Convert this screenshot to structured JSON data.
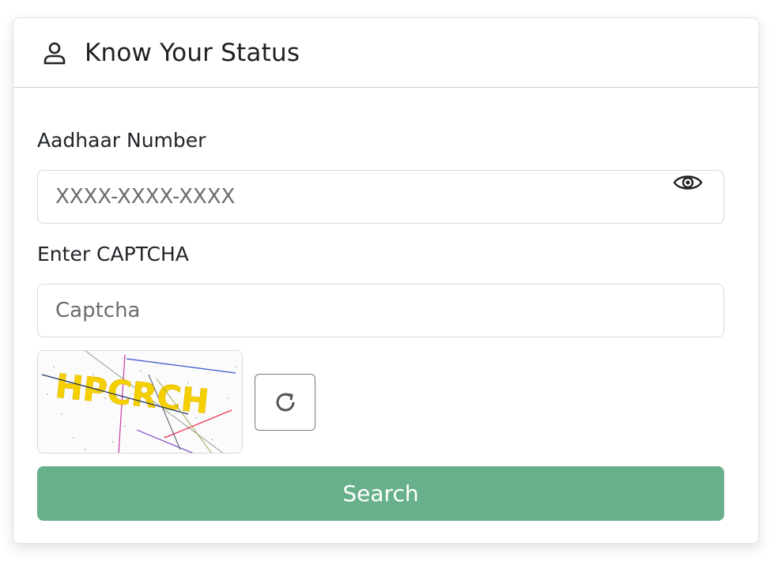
{
  "header": {
    "title": "Know Your Status",
    "icon": "user-icon"
  },
  "form": {
    "aadhaar_label": "Aadhaar Number",
    "aadhaar_placeholder": "XXXX-XXXX-XXXX",
    "aadhaar_value": "",
    "captcha_label": "Enter CAPTCHA",
    "captcha_placeholder": "Captcha",
    "captcha_value": "",
    "captcha_text": "HPCRCH",
    "search_label": "Search"
  },
  "colors": {
    "search_button": "#68b08c",
    "captcha_text": "#f5d000"
  }
}
